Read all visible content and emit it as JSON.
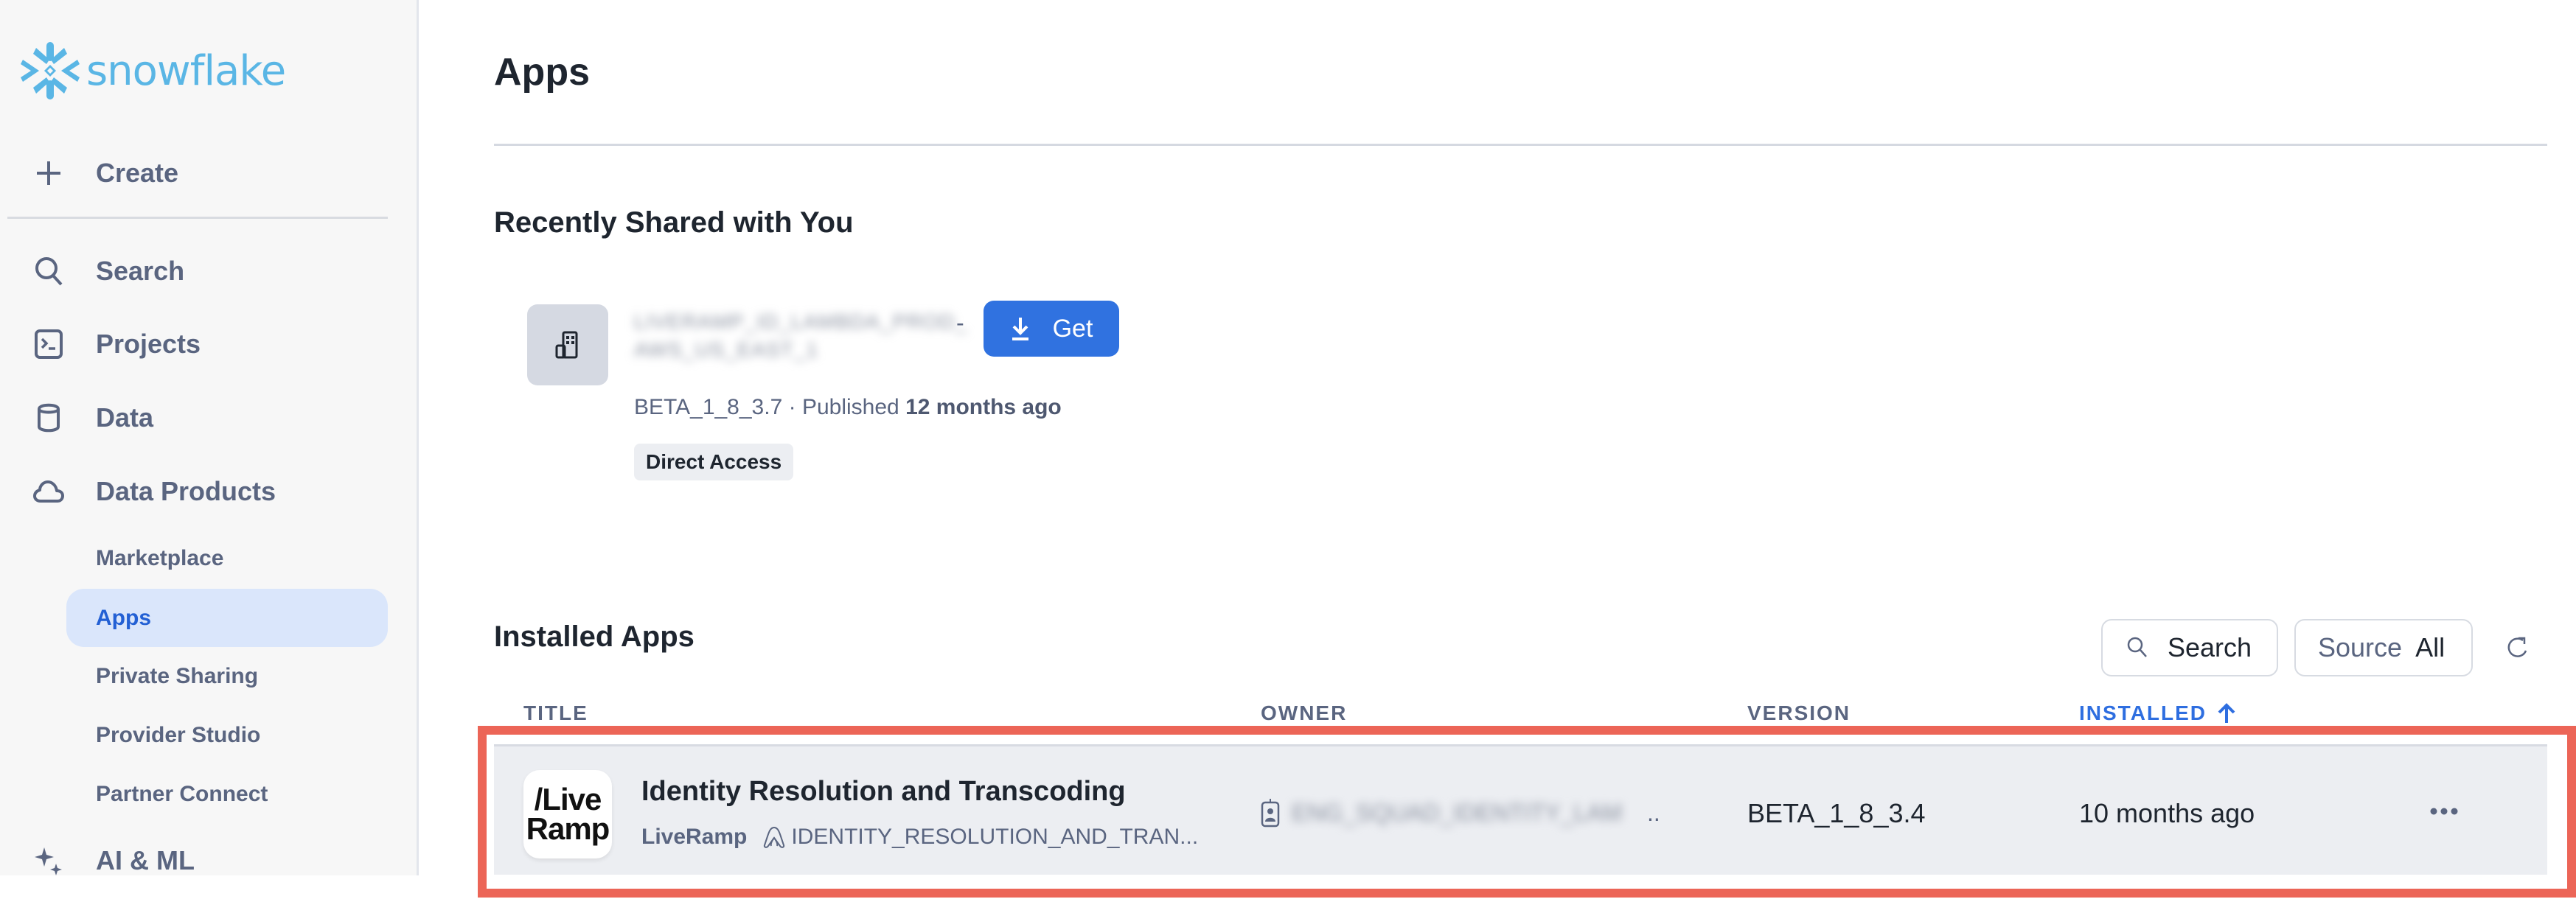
{
  "brand": {
    "name": "snowflake",
    "color": "#5ab6e5"
  },
  "sidebar": {
    "create_label": "Create",
    "items": [
      {
        "label": "Search",
        "icon": "search-icon"
      },
      {
        "label": "Projects",
        "icon": "terminal-icon"
      },
      {
        "label": "Data",
        "icon": "database-icon"
      },
      {
        "label": "Data Products",
        "icon": "cloud-icon"
      }
    ],
    "sub_items": [
      {
        "label": "Marketplace",
        "active": false
      },
      {
        "label": "Apps",
        "active": true
      },
      {
        "label": "Private Sharing",
        "active": false
      },
      {
        "label": "Provider Studio",
        "active": false
      },
      {
        "label": "Partner Connect",
        "active": false
      }
    ],
    "ai_ml_label": "AI & ML"
  },
  "page": {
    "title": "Apps"
  },
  "recently_shared": {
    "title": "Recently Shared with You",
    "listing": {
      "name_blurred": "LIVERAMP_ID_LAMBDA_PROD_ AWS_US_EAST_1",
      "dash": "-",
      "get_label": "Get",
      "version": "BETA_1_8_3.7",
      "separator": "·",
      "published_prefix": "Published",
      "published_time": "12 months ago",
      "tag": "Direct Access"
    }
  },
  "installed_apps": {
    "title": "Installed Apps",
    "toolbar": {
      "search_label": "Search",
      "source_key": "Source",
      "source_value": "All"
    },
    "columns": [
      "TITLE",
      "OWNER",
      "VERSION",
      "INSTALLED"
    ],
    "sorted_column": "INSTALLED",
    "sort_direction": "ascending",
    "rows": [
      {
        "logo_line1": "/Live",
        "logo_line2": "Ramp",
        "title": "Identity Resolution and Transcoding",
        "provider": "LiveRamp",
        "database": "IDENTITY_RESOLUTION_AND_TRAN...",
        "owner_blurred": "ENG_SQUAD_IDENTITY_LAM",
        "owner_ellipsis": "..",
        "version": "BETA_1_8_3.4",
        "installed": "10 months ago"
      }
    ]
  },
  "colors": {
    "accent": "#3072e0",
    "active_nav_bg": "#dae6fb",
    "highlight_border": "#ec6557",
    "row_bg": "#eceef2"
  }
}
